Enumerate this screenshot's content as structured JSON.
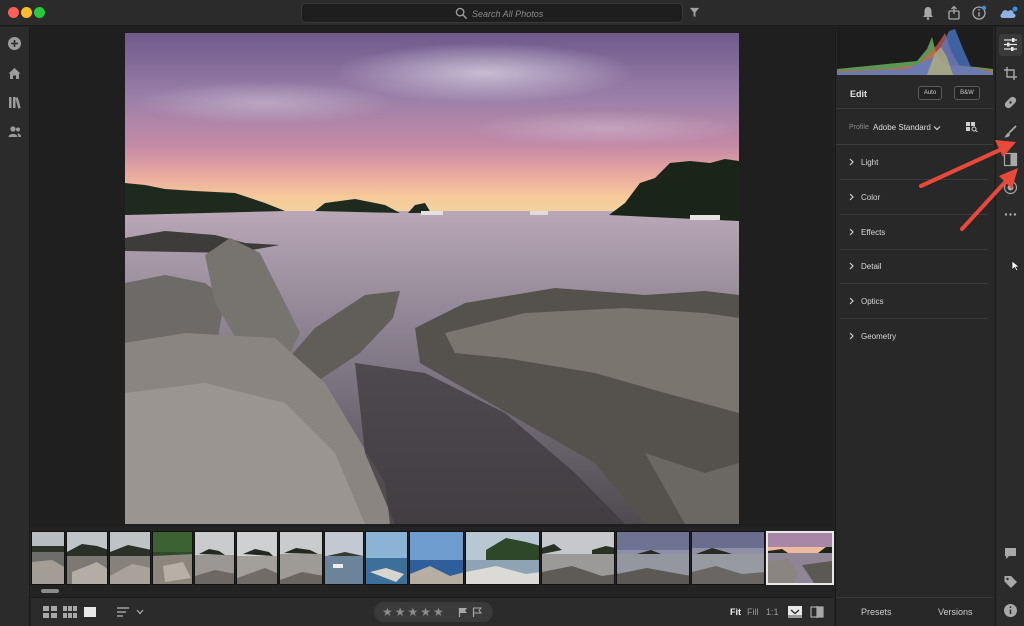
{
  "titlebar": {
    "search_placeholder": "Search All Photos",
    "icons": [
      "search-icon",
      "filter-icon",
      "bell-icon",
      "share-icon",
      "info-icon",
      "cloud-icon"
    ]
  },
  "left_rail": {
    "icons": [
      "add-photos-icon",
      "home-icon",
      "library-icon",
      "people-icon"
    ]
  },
  "edit_panel": {
    "title": "Edit",
    "auto_label": "Auto",
    "bw_label": "B&W",
    "profile_label": "Profile",
    "profile_value": "Adobe Standard",
    "sections": [
      {
        "label": "Light"
      },
      {
        "label": "Color"
      },
      {
        "label": "Effects"
      },
      {
        "label": "Detail"
      },
      {
        "label": "Optics"
      },
      {
        "label": "Geometry"
      }
    ],
    "footer": {
      "presets_label": "Presets",
      "versions_label": "Versions"
    }
  },
  "tools": {
    "icons": [
      "edit-sliders-icon",
      "crop-icon",
      "healing-icon",
      "brush-icon",
      "linear-gradient-icon",
      "radial-gradient-icon",
      "more-icon",
      "comments-icon",
      "keyword-icon",
      "info-icon"
    ]
  },
  "bottombar": {
    "stars": "★★★★★",
    "zoom_fit": "Fit",
    "zoom_fill": "Fill",
    "zoom_1to1": "1:1",
    "icons": [
      "grid-small-icon",
      "grid-large-icon",
      "single-view-icon",
      "sort-icon",
      "chevron-down-icon",
      "flag-pick-icon",
      "flag-reject-icon",
      "filmstrip-toggle-icon",
      "compare-icon"
    ]
  },
  "filmstrip": {
    "thumb_count": 15,
    "selected_index": 14
  },
  "colors": {
    "accent_annotation": "#e9493a",
    "panel_bg": "#282828",
    "canvas_bg": "#1f1f1f"
  }
}
